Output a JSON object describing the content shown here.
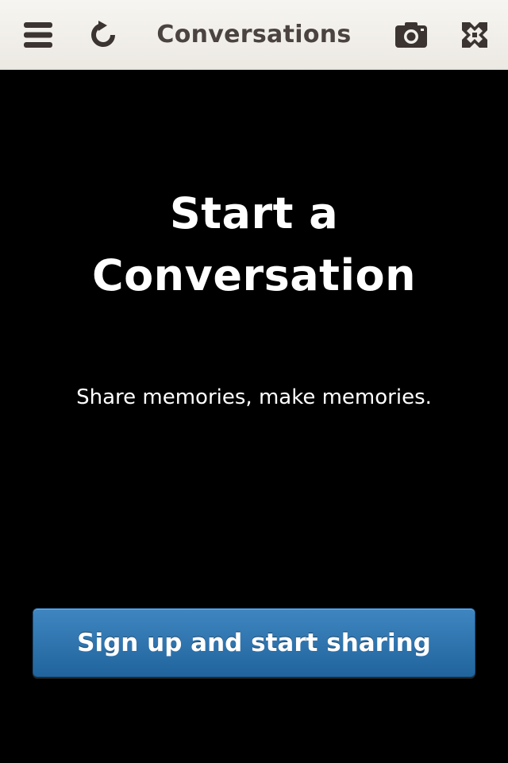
{
  "header": {
    "title": "Conversations",
    "icons": {
      "menu": "menu-icon",
      "refresh": "refresh-icon",
      "camera": "camera-icon",
      "brand": "cross-logo-icon"
    },
    "icon_color": "#3b3431",
    "background": "#f4f2ee"
  },
  "empty_state": {
    "headline": "Start a Conversation",
    "tagline": "Share memories, make memories.",
    "cta_label": "Sign up and start sharing",
    "cta_color": "#2f76b1"
  }
}
